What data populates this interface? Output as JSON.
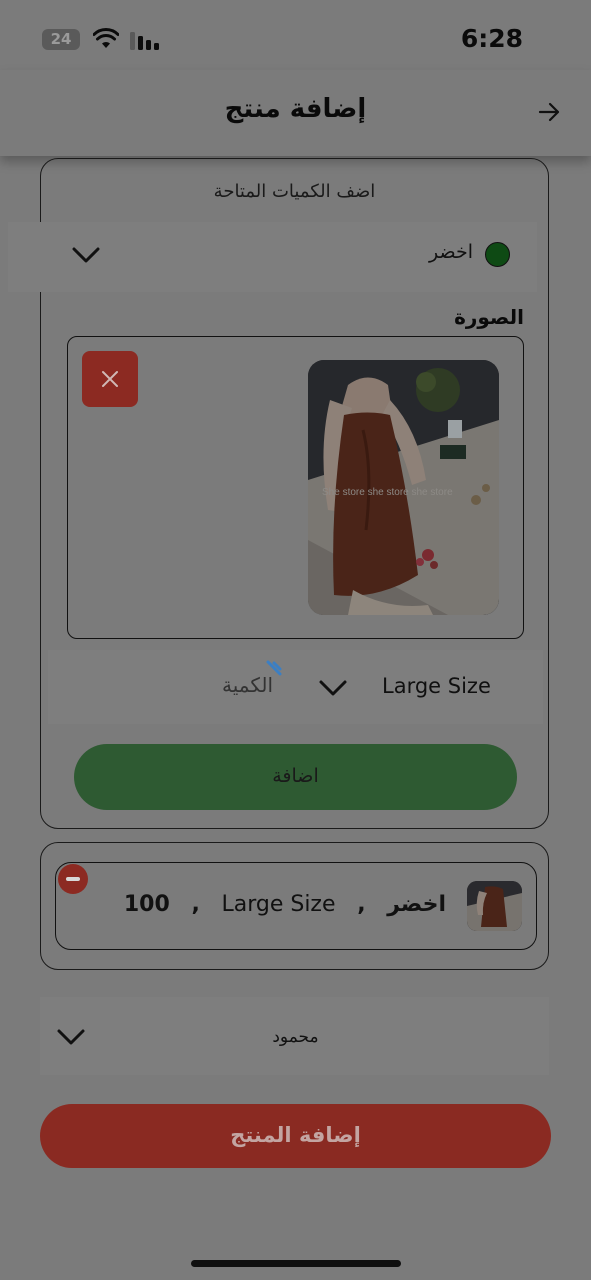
{
  "status": {
    "time": "6:28",
    "battery": "24"
  },
  "header": {
    "title": "إضافة منتج"
  },
  "quantities_card": {
    "heading": "اضف الكميات المتاحة",
    "color": {
      "label": "اخضر",
      "swatch": "#0e4a14"
    },
    "image_label": "الصورة",
    "watermark": "She store she store she store",
    "size_value": "Large Size",
    "quantity_placeholder": "الكمية",
    "add_button": "اضافة"
  },
  "variants": [
    {
      "color": "اخضر",
      "size": "Large Size",
      "quantity": "100"
    }
  ],
  "owner": {
    "value": "محمود"
  },
  "submit_button": "إضافة المنتج",
  "colors": {
    "background": "#7b7b7b",
    "add_button": "#2e5a32",
    "submit_button": "#8a2a22",
    "remove": "#8c2a22"
  }
}
